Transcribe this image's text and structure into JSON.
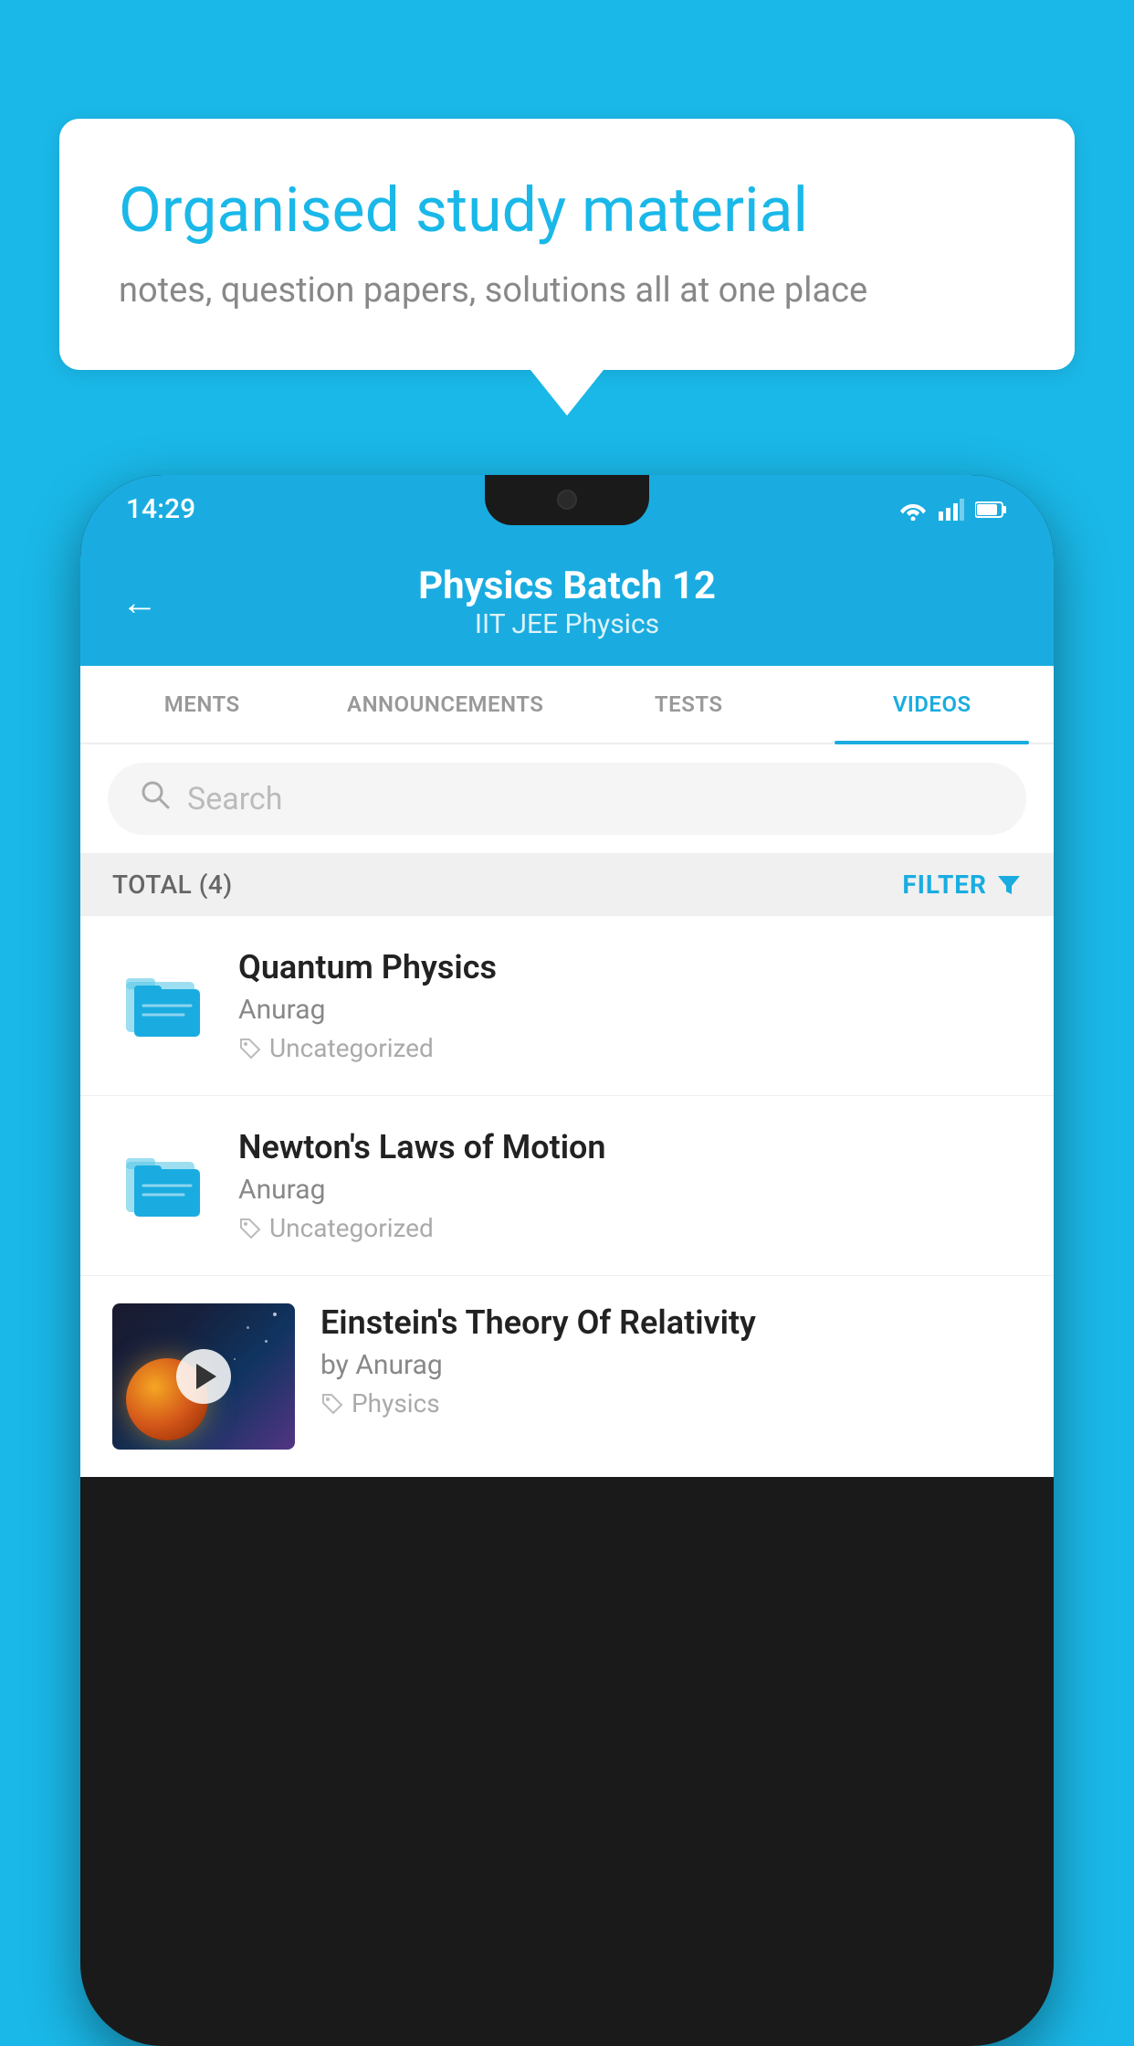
{
  "background_color": "#1ab8e8",
  "speech_bubble": {
    "title": "Organised study material",
    "subtitle": "notes, question papers, solutions all at one place"
  },
  "phone": {
    "status_bar": {
      "time": "14:29",
      "icons": [
        "wifi",
        "signal",
        "battery"
      ]
    },
    "top_bar": {
      "title": "Physics Batch 12",
      "subtitle": "IIT JEE   Physics",
      "back_label": "←"
    },
    "tabs": [
      {
        "label": "MENTS",
        "active": false
      },
      {
        "label": "ANNOUNCEMENTS",
        "active": false
      },
      {
        "label": "TESTS",
        "active": false
      },
      {
        "label": "VIDEOS",
        "active": true
      }
    ],
    "search": {
      "placeholder": "Search"
    },
    "filter_bar": {
      "total": "TOTAL (4)",
      "filter_label": "FILTER"
    },
    "videos": [
      {
        "title": "Quantum Physics",
        "author": "Anurag",
        "tag": "Uncategorized",
        "type": "folder"
      },
      {
        "title": "Newton's Laws of Motion",
        "author": "Anurag",
        "tag": "Uncategorized",
        "type": "folder"
      },
      {
        "title": "Einstein's Theory Of Relativity",
        "author": "by Anurag",
        "tag": "Physics",
        "type": "video"
      }
    ]
  }
}
